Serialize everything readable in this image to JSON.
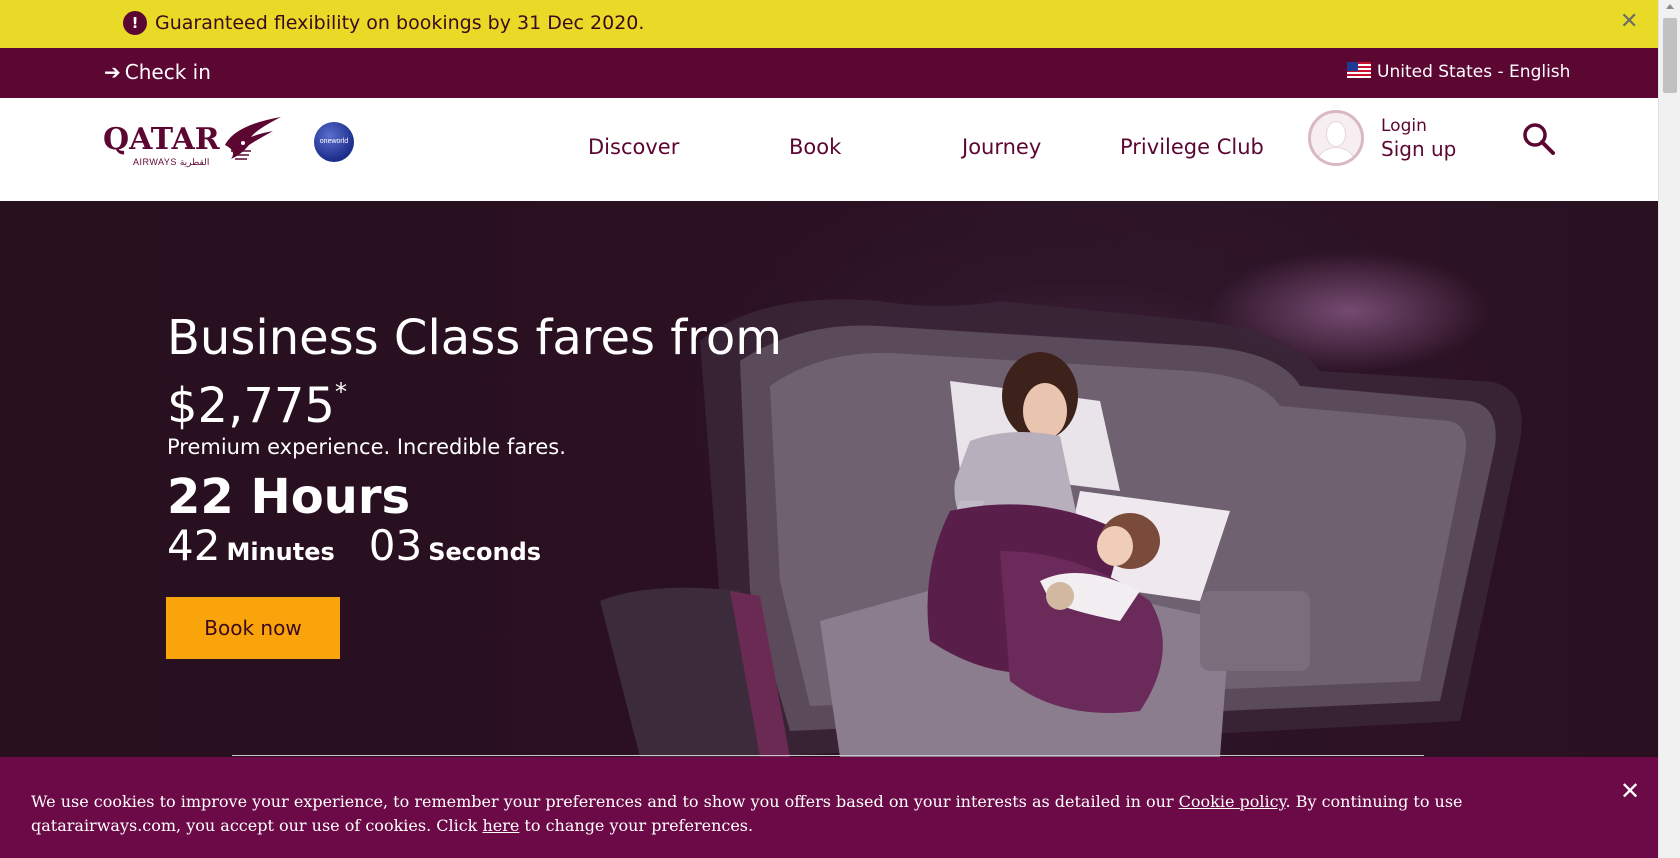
{
  "alert": {
    "icon": "exclamation-icon",
    "text": "Guaranteed flexibility on bookings by 31 Dec 2020.",
    "close": "✕"
  },
  "topbar": {
    "checkin_label": "Check in",
    "locale_label": "United States - English"
  },
  "header": {
    "logo_word": "QATAR",
    "logo_sub": "AIRWAYS القطرية",
    "alliance": "oneworld",
    "nav": [
      "Discover",
      "Book",
      "Journey",
      "Privilege Club"
    ],
    "login_label": "Login",
    "signup_label": "Sign up"
  },
  "hero": {
    "title": "Business Class fares from",
    "price": "$2,775",
    "price_mark": "*",
    "subtitle": "Premium experience. Incredible fares.",
    "hours_value": "22",
    "hours_unit": "Hours",
    "minutes_value": "42",
    "minutes_unit": "Minutes",
    "seconds_value": "03",
    "seconds_unit": "Seconds",
    "cta_label": "Book now"
  },
  "cookie": {
    "text_1": "We use cookies to improve your experience, to remember your preferences and to show you offers based on your interests as detailed in our ",
    "policy_link": "Cookie policy",
    "text_2": ". By continuing to use qatarairways.com, you accept our use of cookies. Click ",
    "here_link": "here",
    "text_3": " to change your preferences.",
    "close": "✕"
  },
  "colors": {
    "brand": "#5c0632",
    "alert_bg": "#e8da27",
    "cta": "#f9a40b",
    "cookie_bg": "#6b0a46"
  }
}
